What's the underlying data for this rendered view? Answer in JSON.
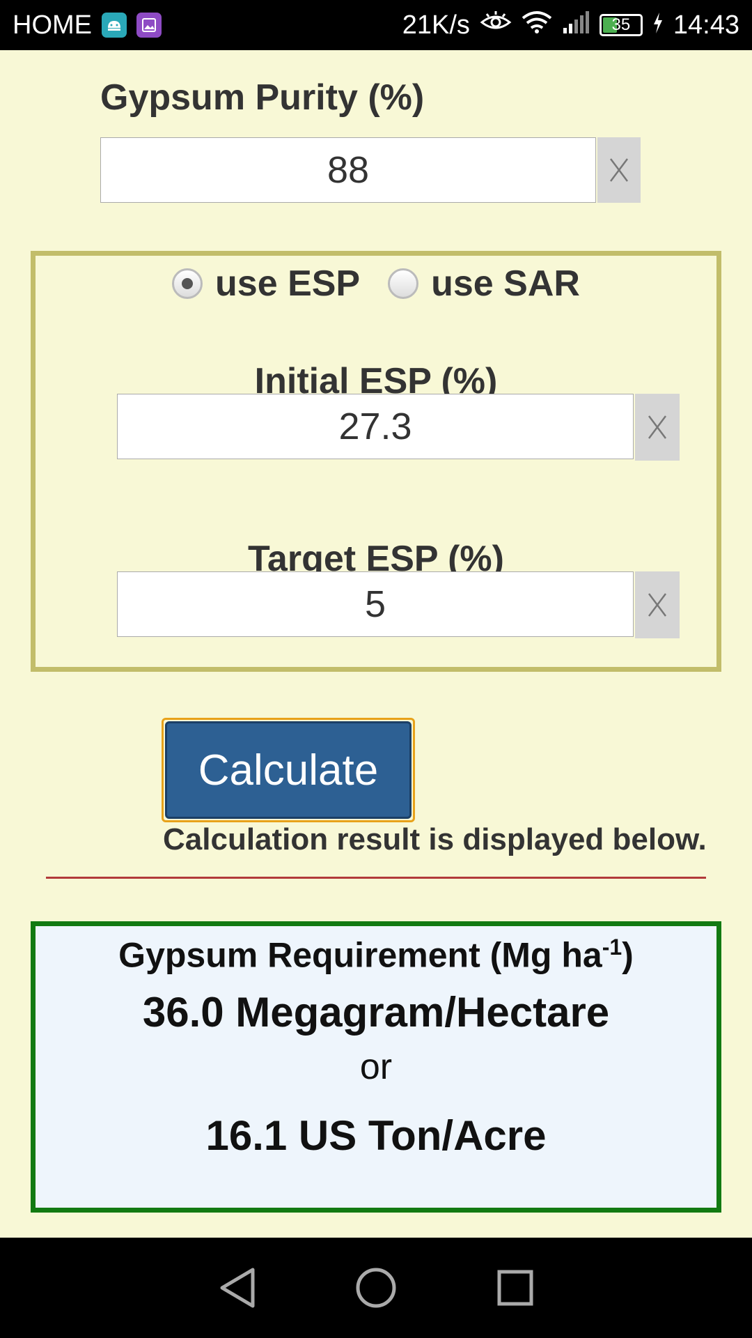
{
  "status_bar": {
    "home_label": "HOME",
    "net_speed": "21K/s",
    "battery": "35",
    "time": "14:43"
  },
  "gypsum_purity": {
    "label": "Gypsum Purity (%)",
    "value": "88",
    "clear_label": "X"
  },
  "mode": {
    "options": [
      "use ESP",
      "use SAR"
    ],
    "selected": "use ESP"
  },
  "initial_esp": {
    "label": "Initial ESP (%)",
    "value": "27.3",
    "clear_label": "X"
  },
  "target_esp": {
    "label": "Target ESP (%)",
    "value": "5",
    "clear_label": "X"
  },
  "calculate": {
    "label": "Calculate",
    "note": "Calculation result is displayed below."
  },
  "result": {
    "title_main": "Gypsum Requirement (Mg ha",
    "title_sup": "-1",
    "title_end": ")",
    "metric": "36.0 Megagram/Hectare",
    "or": "or",
    "us": "16.1 US Ton/Acre"
  },
  "colors": {
    "background": "#f8f8d6",
    "esp_border": "#c2bd6a",
    "button": "#2d6093",
    "button_focus": "#e8a21a",
    "divider": "#b23a3a",
    "result_border": "#127a12",
    "result_bg": "#eef5fc"
  }
}
